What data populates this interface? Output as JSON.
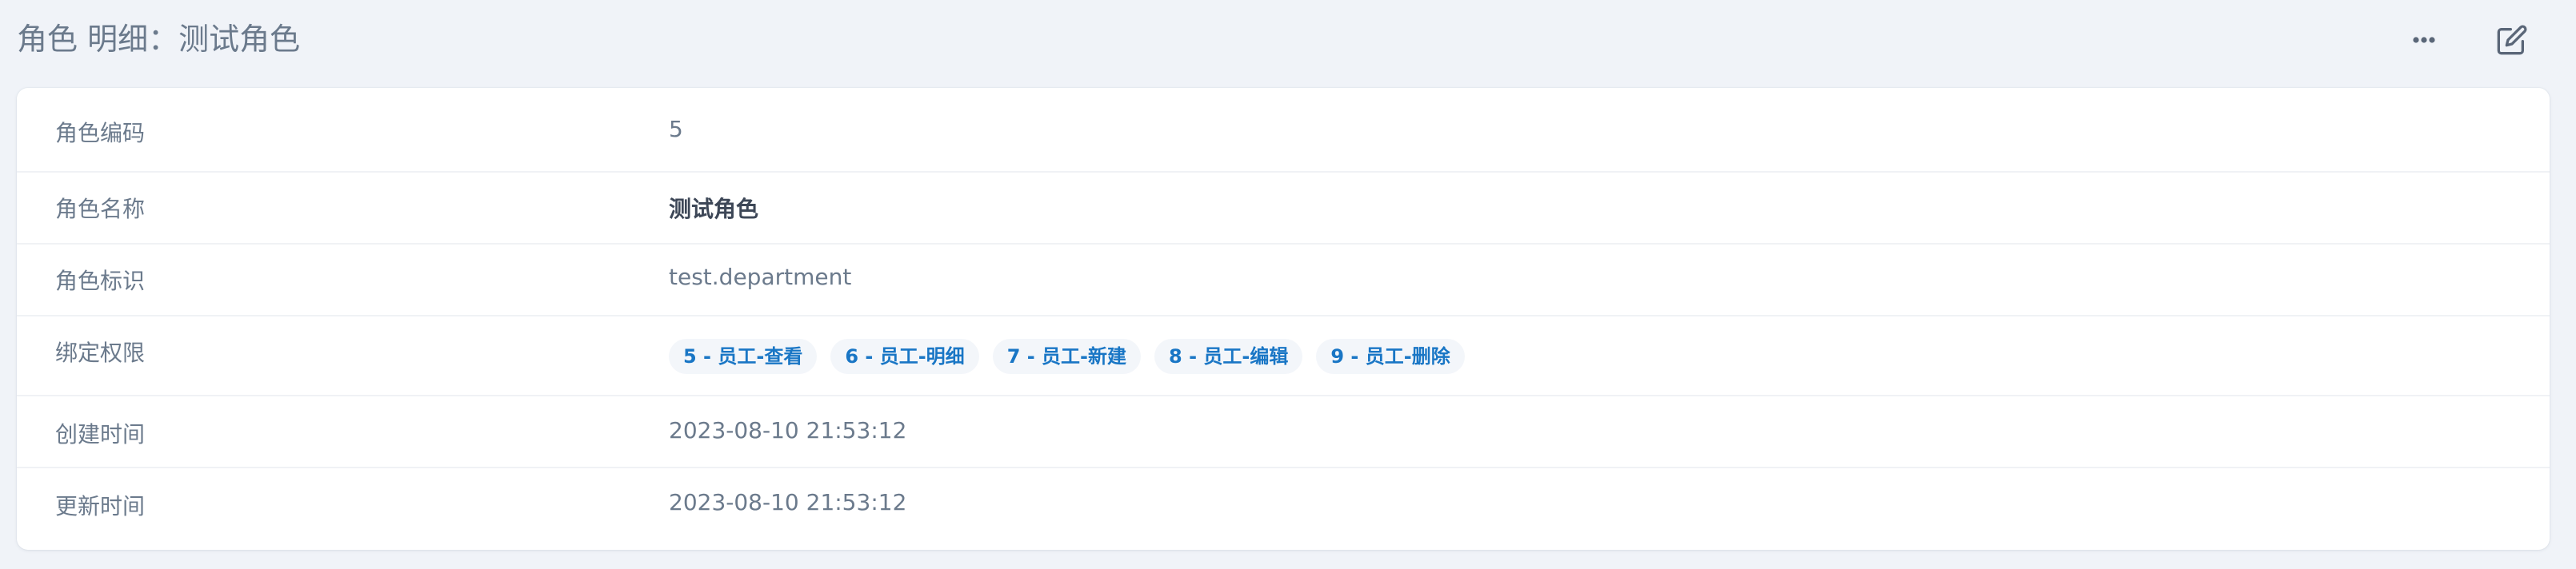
{
  "header": {
    "title": "角色 明细：测试角色",
    "more_icon": "more-horizontal-icon",
    "edit_icon": "edit-icon"
  },
  "details": {
    "code": {
      "label": "角色编码",
      "value": "5"
    },
    "name": {
      "label": "角色名称",
      "value": "测试角色"
    },
    "identifier": {
      "label": "角色标识",
      "value": "test.department"
    },
    "permissions": {
      "label": "绑定权限",
      "tags": [
        "5 - 员工-查看",
        "6 - 员工-明细",
        "7 - 员工-新建",
        "8 - 员工-编辑",
        "9 - 员工-删除"
      ]
    },
    "created": {
      "label": "创建时间",
      "value": "2023-08-10 21:53:12"
    },
    "updated": {
      "label": "更新时间",
      "value": "2023-08-10 21:53:12"
    }
  },
  "colors": {
    "background": "#f0f3f8",
    "card": "#ffffff",
    "tag_text": "#1976c5",
    "tag_background": "#f3f6fa"
  }
}
